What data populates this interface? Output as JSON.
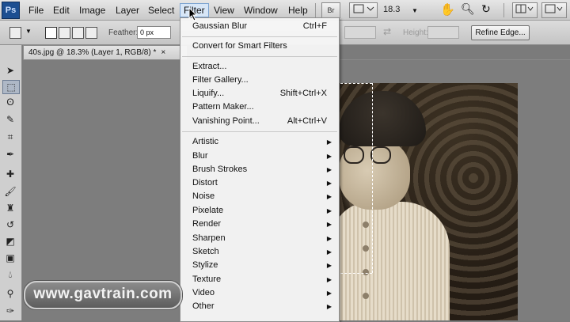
{
  "app": {
    "logo": "Ps"
  },
  "menubar": {
    "items": [
      "File",
      "Edit",
      "Image",
      "Layer",
      "Select",
      "Filter",
      "View",
      "Window",
      "Help"
    ],
    "active": "Filter",
    "br_label": "Br",
    "zoom": "18.3"
  },
  "options": {
    "feather_label": "Feather:",
    "feather_value": "0 px",
    "height_label": "Height:",
    "refine_edge": "Refine Edge..."
  },
  "document": {
    "tab_title": "40s.jpg @ 18.3% (Layer 1, RGB/8) *",
    "close_glyph": "×"
  },
  "filter_menu": {
    "last_filter": {
      "label": "Gaussian Blur",
      "shortcut": "Ctrl+F"
    },
    "smart": "Convert for Smart Filters",
    "group1": [
      {
        "label": "Extract...",
        "shortcut": ""
      },
      {
        "label": "Filter Gallery...",
        "shortcut": ""
      },
      {
        "label": "Liquify...",
        "shortcut": "Shift+Ctrl+X"
      },
      {
        "label": "Pattern Maker...",
        "shortcut": ""
      },
      {
        "label": "Vanishing Point...",
        "shortcut": "Alt+Ctrl+V"
      }
    ],
    "submenus": [
      "Artistic",
      "Blur",
      "Brush Strokes",
      "Distort",
      "Noise",
      "Pixelate",
      "Render",
      "Sharpen",
      "Sketch",
      "Stylize",
      "Texture",
      "Video",
      "Other"
    ]
  },
  "watermark": "www.gavtrain.com",
  "colors": {
    "menu_highlight": "#d7e6f7",
    "accent": "#1d4f91"
  }
}
